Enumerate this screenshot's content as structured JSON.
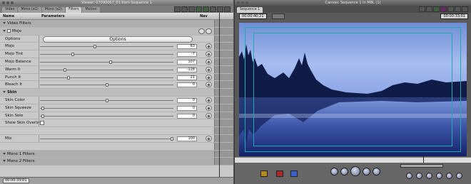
{
  "viewer": {
    "title": "Viewer: 07090067_01 from Sequence 1",
    "tabs": [
      "Video",
      "Mono (a1)",
      "Mono (a2)",
      "Filters",
      "Motion"
    ],
    "active_tab": "Filters",
    "columns": {
      "name": "Name",
      "parameters": "Parameters",
      "nav": "Nav"
    },
    "sections": {
      "video_filters": "Video Filters",
      "mojo": "Mojo",
      "skin": "Skin",
      "mono1": "Mono 1 Filters",
      "mono2": "Mono 2 Filters"
    },
    "options_label": "Options",
    "options_button": "Options",
    "params": [
      {
        "name": "Mojo",
        "value": "83",
        "level": 0.41
      },
      {
        "name": "Mojo Tint",
        "value": "-7",
        "level": 0.24
      },
      {
        "name": "Mojo Balance",
        "value": "107",
        "level": 0.53
      },
      {
        "name": "Warm It",
        "value": "-128",
        "level": 0.18
      },
      {
        "name": "Punch It",
        "value": "21",
        "level": 0.21
      },
      {
        "name": "Bleach It",
        "value": "0",
        "level": 0.5
      }
    ],
    "skin_params": [
      {
        "name": "Skin Color",
        "value": "0",
        "level": 0.5
      },
      {
        "name": "Skin Squeeze",
        "value": "0",
        "level": 0.01
      },
      {
        "name": "Skin Solo",
        "value": "0",
        "level": 0.01
      }
    ],
    "overlay_label": "Show Skin Overlay",
    "mix": {
      "name": "Mix",
      "value": "100",
      "level": 1.0
    },
    "timecode": "00:00:33;01"
  },
  "canvas": {
    "title": "Canvas: Sequence 1 in MBL (1)",
    "tab": "Sequence 1",
    "timecode_left": "00:00:40;21",
    "timecode_right": "00:00:33;01"
  },
  "colors": {
    "accent": "#3a5fc8",
    "image_sky": "#8aa6e0",
    "image_water": "#1c2c70"
  }
}
